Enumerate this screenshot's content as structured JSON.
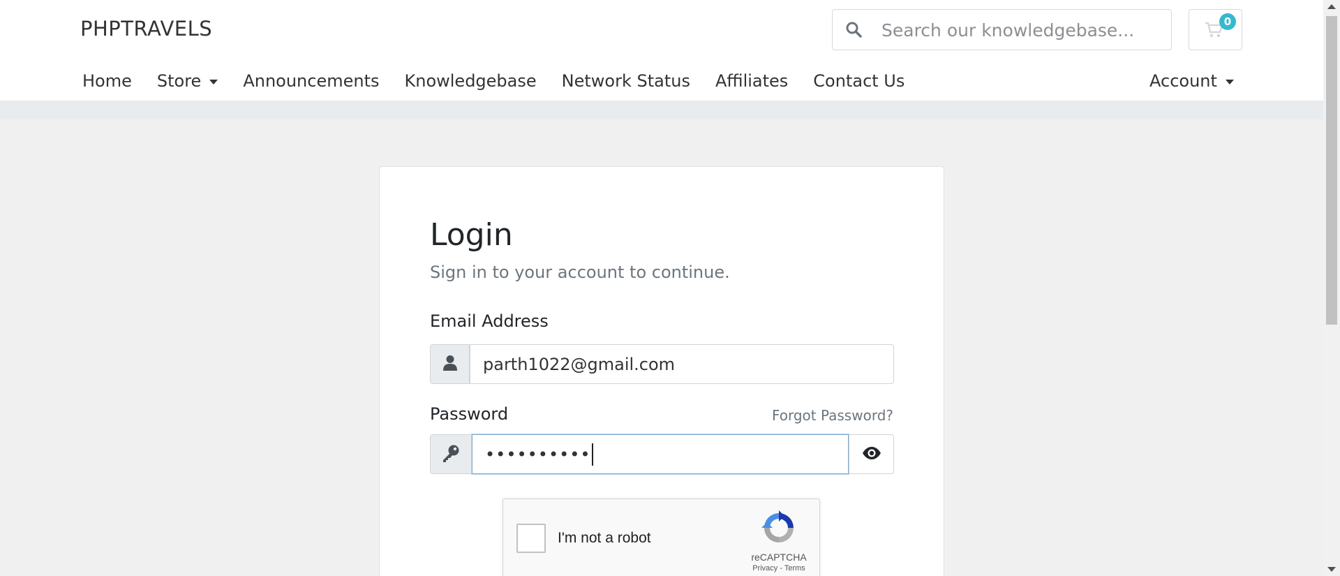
{
  "header": {
    "brand": "PHPTRAVELS",
    "search_placeholder": "Search our knowledgebase...",
    "cart_count": "0"
  },
  "nav": {
    "items": [
      {
        "label": "Home"
      },
      {
        "label": "Store"
      },
      {
        "label": "Announcements"
      },
      {
        "label": "Knowledgebase"
      },
      {
        "label": "Network Status"
      },
      {
        "label": "Affiliates"
      },
      {
        "label": "Contact Us"
      }
    ],
    "account_label": "Account"
  },
  "login": {
    "title": "Login",
    "subtitle": "Sign in to your account to continue.",
    "email_label": "Email Address",
    "email_value": "parth1022@gmail.com",
    "password_label": "Password",
    "forgot_label": "Forgot Password?",
    "password_masked": "••••••••••"
  },
  "captcha": {
    "text": "I'm not a robot",
    "brand": "reCAPTCHA",
    "privacy": "Privacy",
    "separator": "-",
    "terms": "Terms"
  },
  "icons": {
    "search": "search-icon",
    "cart": "cart-icon",
    "user": "user-icon",
    "key": "key-icon",
    "eye": "eye-icon",
    "recaptcha": "recaptcha-icon"
  },
  "colors": {
    "accent_badge": "#36b9cc",
    "focus_border": "#80a8c8"
  }
}
